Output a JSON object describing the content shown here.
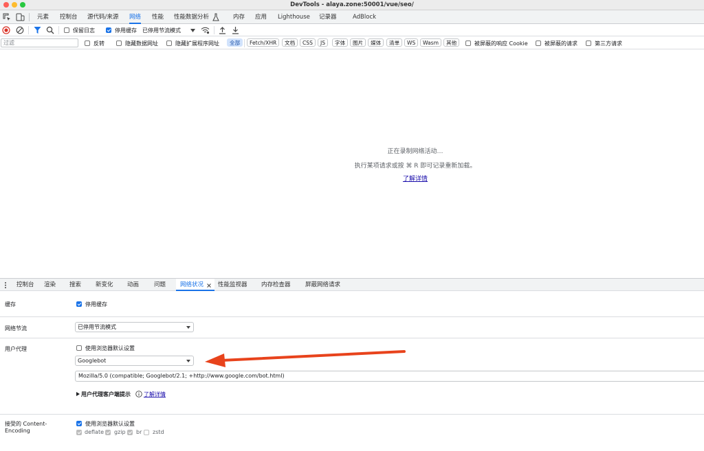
{
  "window": {
    "title": "DevTools - alaya.zone:50001/vue/seo/"
  },
  "main_tabs": [
    {
      "label": "元素"
    },
    {
      "label": "控制台"
    },
    {
      "label": "源代码/来源"
    },
    {
      "label": "网络",
      "active": true
    },
    {
      "label": "性能"
    },
    {
      "label": "性能数据分析"
    },
    {
      "label": "内存"
    },
    {
      "label": "应用"
    },
    {
      "label": "Lighthouse"
    },
    {
      "label": "记录器"
    },
    {
      "label": "AdBlock"
    }
  ],
  "toolbar": {
    "preserve_log": "保留日志",
    "disable_cache": "停用缓存",
    "throttling": "已停用节流模式"
  },
  "filter_bar": {
    "placeholder": "过滤",
    "invert": "反转",
    "hide_data_urls": "隐藏数据网址",
    "hide_extension_urls": "隐藏扩展程序网址",
    "types": [
      "全部",
      "Fetch/XHR",
      "文档",
      "CSS",
      "JS",
      "字体",
      "图片",
      "媒体",
      "清单",
      "WS",
      "Wasm",
      "其他"
    ],
    "blocked_cookies": "被屏蔽的响应 Cookie",
    "blocked_requests": "被屏蔽的请求",
    "third_party": "第三方请求"
  },
  "empty_state": {
    "line1": "正在录制网络活动…",
    "line2": "执行某项请求或按 ⌘ R 即可记录重新加载。",
    "link": "了解详情"
  },
  "drawer_tabs": [
    {
      "label": "控制台"
    },
    {
      "label": "渲染"
    },
    {
      "label": "搜索"
    },
    {
      "label": "新变化"
    },
    {
      "label": "动画"
    },
    {
      "label": "问题"
    },
    {
      "label": "网络状况",
      "active": true
    },
    {
      "label": "性能监视器"
    },
    {
      "label": "内存检查器"
    },
    {
      "label": "屏蔽网络请求"
    }
  ],
  "conditions": {
    "cache_label": "缓存",
    "cache_checkbox": "停用缓存",
    "throttle_label": "网络节流",
    "throttle_value": "已停用节流模式",
    "ua_label": "用户代理",
    "ua_default_checkbox": "使用浏览器默认设置",
    "ua_select": "Googlebot",
    "ua_string": "Mozilla/5.0 (compatible; Googlebot/2.1; +http://www.google.com/bot.html)",
    "client_hints": "用户代理客户端提示",
    "client_hints_link": "了解详情",
    "encoding_label_1": "接受的 Content-",
    "encoding_label_2": "Encoding",
    "encoding_default_checkbox": "使用浏览器默认设置",
    "encodings": [
      "deflate",
      "gzip",
      "br",
      "zstd"
    ]
  },
  "colors": {
    "accent": "#1a73e8",
    "arrow": "#e8431c",
    "record": "#d93025"
  }
}
